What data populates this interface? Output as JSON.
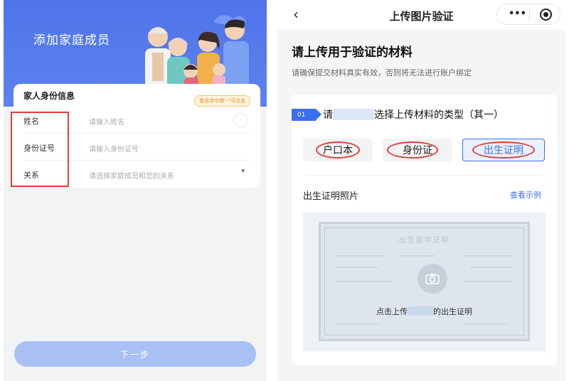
{
  "left": {
    "hero_title": "添加家庭成员",
    "card_title": "家人身份信息",
    "hint_tag": "若名字中带\"·\"可点击",
    "fields": [
      {
        "label": "姓名",
        "placeholder": "请输入姓名",
        "action": "·"
      },
      {
        "label": "身份证号",
        "placeholder": "请输入身份证号"
      },
      {
        "label": "关系",
        "placeholder": "请选择家庭成员和您的关系",
        "action": "▾"
      }
    ],
    "next_button": "下一步",
    "colors": {
      "hero": "#4e74e8",
      "annotation": "#d9413a",
      "button": "#a9c0f5"
    }
  },
  "right": {
    "nav": {
      "back_icon": "chevron-left-icon",
      "title": "上传图片验证",
      "more_icon": "more-dots-icon",
      "target_icon": "target-icon"
    },
    "main_title": "请上传用于验证的材料",
    "main_subtitle": "请确保提交材料真实有效，否则将无法进行账户绑定",
    "step": {
      "number": "01",
      "prefix": "请",
      "suffix": "选择上传材料的类型（其一）"
    },
    "types": [
      {
        "label": "户口本",
        "selected": false
      },
      {
        "label": "身份证",
        "selected": false
      },
      {
        "label": "出生证明",
        "selected": true
      }
    ],
    "photo_title": "出生证明照片",
    "photo_link": "查看示例",
    "certificate_title": "出生医学证明",
    "upload_prefix": "点击上传",
    "upload_suffix": "的出生证明",
    "colors": {
      "accent": "#3a6ff0",
      "annotation": "#d9413a"
    }
  }
}
